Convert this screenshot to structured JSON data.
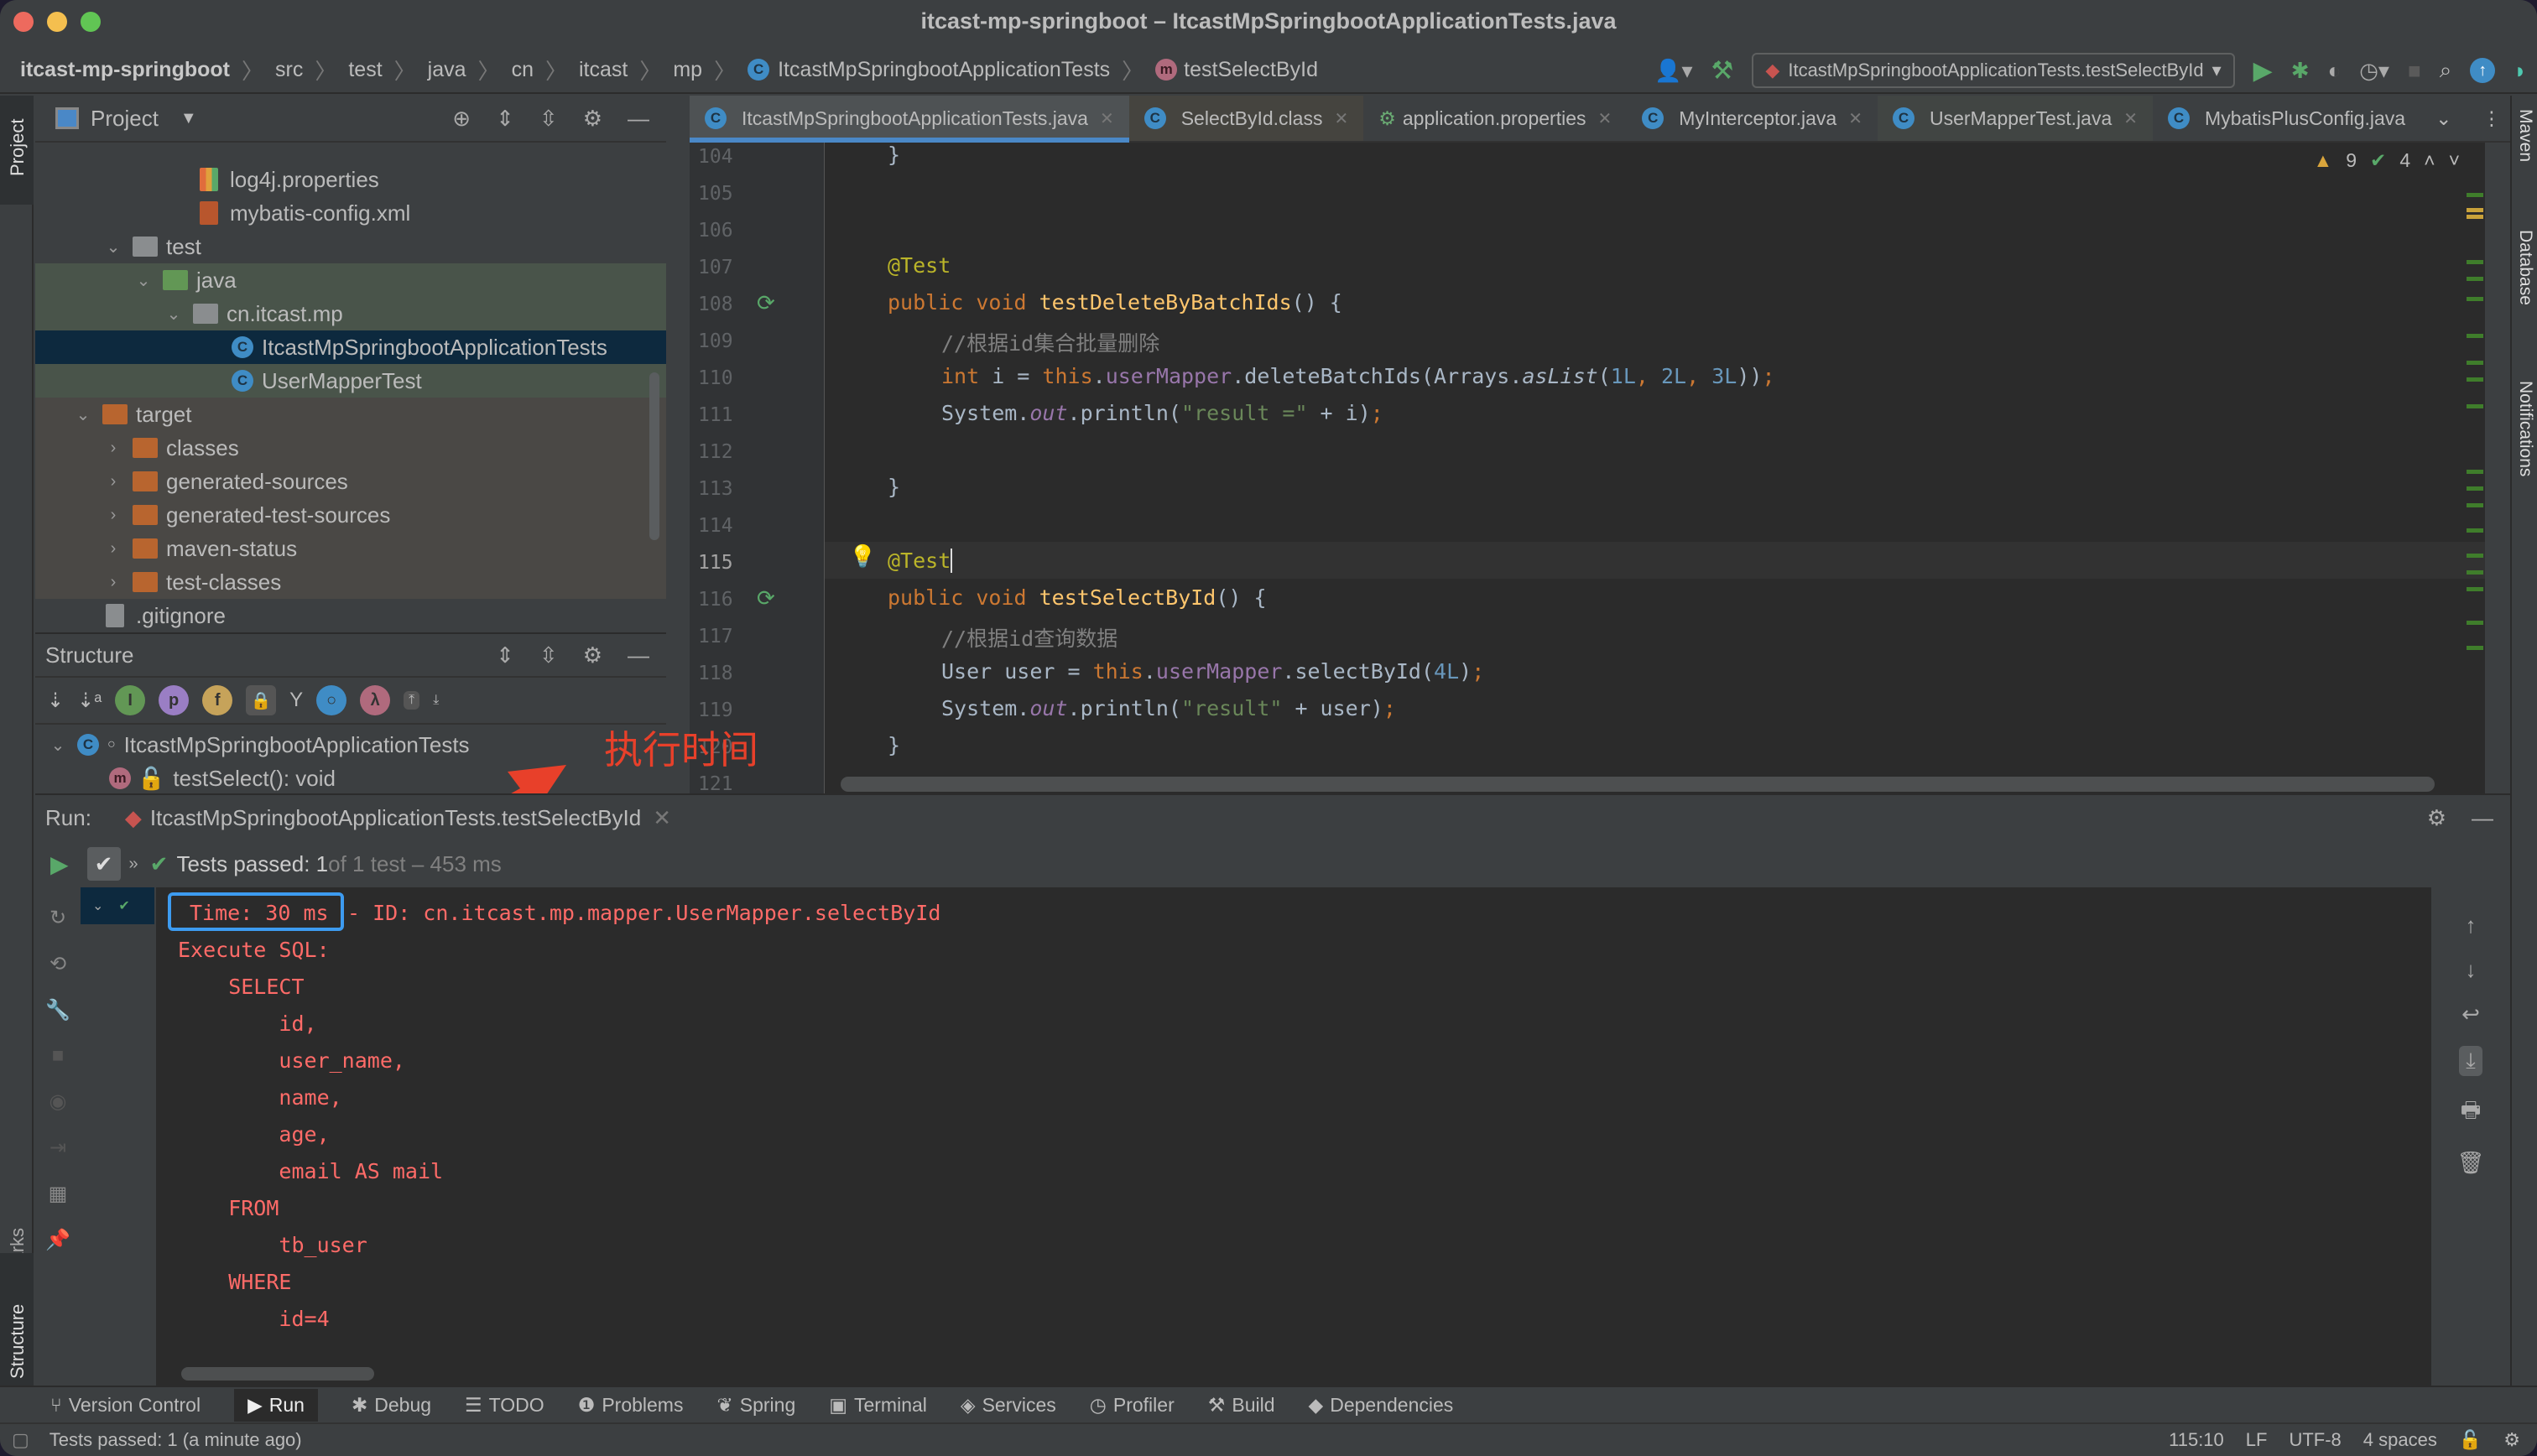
{
  "window": {
    "title": "itcast-mp-springboot – ItcastMpSpringbootApplicationTests.java"
  },
  "navbar": {
    "breadcrumbs": [
      "itcast-mp-springboot",
      "src",
      "test",
      "java",
      "cn",
      "itcast",
      "mp",
      "ItcastMpSpringbootApplicationTests",
      "testSelectById"
    ],
    "run_config": "ItcastMpSpringbootApplicationTests.testSelectById"
  },
  "left_stripe": {
    "project": "Project",
    "bookmarks": "Bookmarks",
    "structure": "Structure"
  },
  "right_stripe": {
    "maven": "Maven",
    "database": "Database",
    "notifications": "Notifications"
  },
  "project_panel": {
    "title": "Project",
    "items": [
      {
        "label": "log4j.properties",
        "type": "file"
      },
      {
        "label": "mybatis-config.xml",
        "type": "xml"
      },
      {
        "label": "test",
        "type": "folder"
      },
      {
        "label": "java",
        "type": "folder-green"
      },
      {
        "label": "cn.itcast.mp",
        "type": "package"
      },
      {
        "label": "ItcastMpSpringbootApplicationTests",
        "type": "class",
        "selected": true
      },
      {
        "label": "UserMapperTest",
        "type": "class"
      },
      {
        "label": "target",
        "type": "folder-orange"
      },
      {
        "label": "classes",
        "type": "folder-orange"
      },
      {
        "label": "generated-sources",
        "type": "folder-orange"
      },
      {
        "label": "generated-test-sources",
        "type": "folder-orange"
      },
      {
        "label": "maven-status",
        "type": "folder-orange"
      },
      {
        "label": "test-classes",
        "type": "folder-orange"
      },
      {
        "label": ".gitignore",
        "type": "file"
      }
    ]
  },
  "structure_panel": {
    "title": "Structure",
    "class_name": "ItcastMpSpringbootApplicationTests",
    "method": "testSelect(): void"
  },
  "editor": {
    "tabs": [
      {
        "label": "ItcastMpSpringbootApplicationTests.java",
        "active": true
      },
      {
        "label": "SelectById.class"
      },
      {
        "label": "application.properties"
      },
      {
        "label": "MyInterceptor.java"
      },
      {
        "label": "UserMapperTest.java"
      },
      {
        "label": "MybatisPlusConfig.java"
      }
    ],
    "warnings": "9",
    "checks": "4",
    "line_numbers": [
      "104",
      "105",
      "106",
      "107",
      "108",
      "109",
      "110",
      "111",
      "112",
      "113",
      "114",
      "115",
      "116",
      "117",
      "118",
      "119",
      "120",
      "121"
    ],
    "current_line": "115",
    "code": {
      "l104": "}",
      "l107_at": "@Test",
      "l108_pub": "public void ",
      "l108_fn": "testDeleteByBatchIds",
      "l108_rest": "() {",
      "l109": "//根据id集合批量删除",
      "l110_int": "int",
      "l110_a": " i = ",
      "l110_this": "this",
      "l110_dot": ".",
      "l110_fld": "userMapper",
      "l110_b": ".deleteBatchIds(Arrays.",
      "l110_aslist": "asList",
      "l110_c": "(",
      "l110_n1": "1L",
      "l110_n2": "2L",
      "l110_n3": "3L",
      "l110_end": "))",
      "l111_a": "System.",
      "l111_out": "out",
      "l111_b": ".println(",
      "l111_str": "\"result =\"",
      "l111_c": " + i)",
      "l113": "}",
      "l115": "@Test",
      "l116_pub": "public void ",
      "l116_fn": "testSelectById",
      "l116_rest": "() {",
      "l117": "//根据id查询数据",
      "l118_a": "User user = ",
      "l118_this": "this",
      "l118_fld": "userMapper",
      "l118_b": ".selectById(",
      "l118_num": "4L",
      "l118_c": ")",
      "l119_a": "System.",
      "l119_out": "out",
      "l119_b": ".println(",
      "l119_str": "\"result\"",
      "l119_c": " + user)",
      "l120": "}",
      "semicolon": ";"
    }
  },
  "annotation": {
    "label": "执行时间",
    "color": "#e8402a"
  },
  "run_panel": {
    "label": "Run:",
    "tab": "ItcastMpSpringbootApplicationTests.testSelectById",
    "status_main": "Tests passed: 1",
    "status_rest": " of 1 test – 453 ms",
    "console": {
      "time": "Time: 30 ms",
      "id": "- ID: cn.itcast.mp.mapper.UserMapper.selectById",
      "lines": [
        "Execute SQL:",
        "    SELECT",
        "        id,",
        "        user_name,",
        "        name,",
        "        age,",
        "        email AS mail",
        "    FROM",
        "        tb_user",
        "    WHERE",
        "        id=4"
      ]
    }
  },
  "bottom_tools": [
    "Version Control",
    "Run",
    "Debug",
    "TODO",
    "Problems",
    "Spring",
    "Terminal",
    "Services",
    "Profiler",
    "Build",
    "Dependencies"
  ],
  "status_bar": {
    "message": "Tests passed: 1 (a minute ago)",
    "position": "115:10",
    "line_sep": "LF",
    "encoding": "UTF-8",
    "indent": "4 spaces"
  }
}
